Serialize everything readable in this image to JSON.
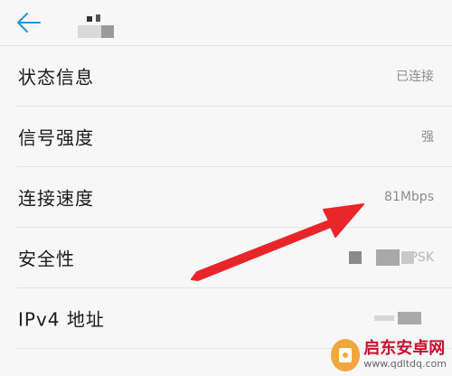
{
  "rows": [
    {
      "label": "状态信息",
      "value": "已连接"
    },
    {
      "label": "信号强度",
      "value": "强"
    },
    {
      "label": "连接速度",
      "value": "81Mbps"
    },
    {
      "label": "安全性",
      "value": "PSK"
    },
    {
      "label": "IPv4 地址",
      "value": ""
    }
  ],
  "watermark": {
    "title": "启东安卓网",
    "url": "www.qdltdq.com"
  },
  "colors": {
    "accent": "#1e96d6",
    "arrow": "#e8262a"
  }
}
